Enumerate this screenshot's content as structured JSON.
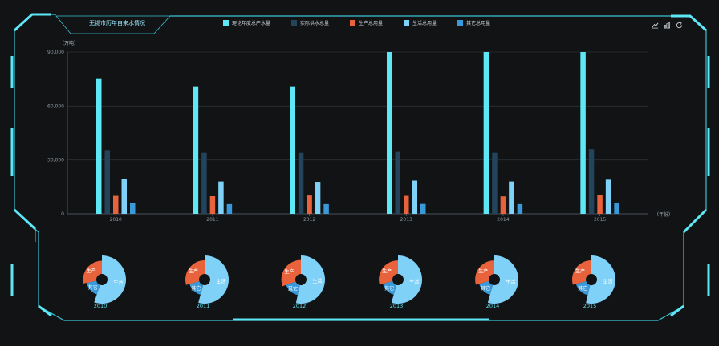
{
  "header": {
    "title": "无锡市历年自来水情况"
  },
  "legend": [
    {
      "label": "理论年度总产水量",
      "color": "#5ee7f5"
    },
    {
      "label": "实际供水总量",
      "color": "#24445c"
    },
    {
      "label": "生产总用量",
      "color": "#e8623c"
    },
    {
      "label": "生活总用量",
      "color": "#7fd1f7"
    },
    {
      "label": "其它总用量",
      "color": "#3a9ad9"
    }
  ],
  "tools": [
    {
      "icon": "line-chart-icon"
    },
    {
      "icon": "bar-chart-icon"
    },
    {
      "icon": "refresh-icon"
    }
  ],
  "chart_data": [
    {
      "type": "bar",
      "ylabel": "（万吨）",
      "xlabel": "（年份）",
      "categories": [
        "2010",
        "2011",
        "2012",
        "2013",
        "2014",
        "2015"
      ],
      "ylim": [
        0,
        90000
      ],
      "yticks": [
        "0",
        "30,000",
        "60,000",
        "90,000"
      ],
      "grid": true,
      "series": [
        {
          "name": "理论年度总产水量",
          "color": "#5ee7f5",
          "values": [
            75000,
            71000,
            71000,
            90000,
            90000,
            90000
          ]
        },
        {
          "name": "实际供水总量",
          "color": "#24445c",
          "values": [
            35500,
            34000,
            34000,
            34500,
            34000,
            36000
          ]
        },
        {
          "name": "生产总用量",
          "color": "#e8623c",
          "values": [
            10000,
            9800,
            10200,
            10000,
            9700,
            10400
          ]
        },
        {
          "name": "生活总用量",
          "color": "#7fd1f7",
          "values": [
            19500,
            18000,
            17800,
            18500,
            18000,
            19000
          ]
        },
        {
          "name": "其它总用量",
          "color": "#3a9ad9",
          "values": [
            5800,
            5400,
            5400,
            5500,
            5400,
            6000
          ]
        }
      ]
    },
    {
      "type": "pie",
      "style": "rose",
      "slice_labels": [
        "生产",
        "生活",
        "其它"
      ],
      "slice_colors": [
        "#e8623c",
        "#7fd1f7",
        "#3a9ad9"
      ],
      "charts": [
        {
          "year": "2010",
          "values": [
            10000,
            19500,
            5800
          ]
        },
        {
          "year": "2011",
          "values": [
            9800,
            18000,
            5400
          ]
        },
        {
          "year": "2012",
          "values": [
            10200,
            17800,
            5400
          ]
        },
        {
          "year": "2013",
          "values": [
            10000,
            18500,
            5500
          ]
        },
        {
          "year": "2014",
          "values": [
            9700,
            18000,
            5400
          ]
        },
        {
          "year": "2015",
          "values": [
            10400,
            19000,
            6000
          ]
        }
      ]
    }
  ]
}
